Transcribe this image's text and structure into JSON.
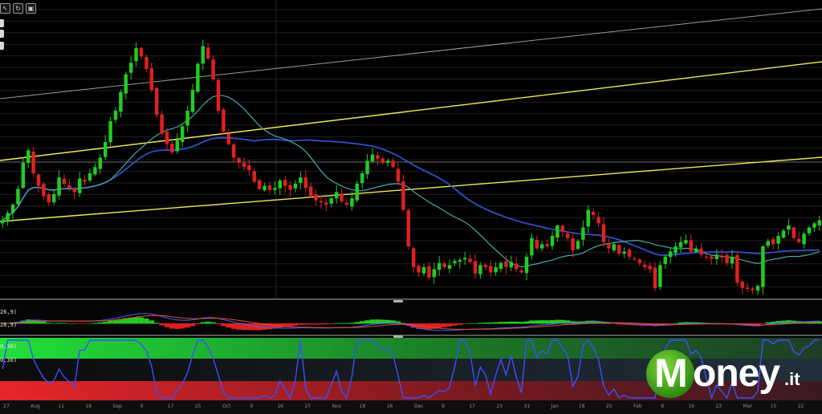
{
  "toolbar": {
    "buttons": [
      {
        "name": "cursor-tool",
        "glyph": "↖"
      },
      {
        "name": "refresh-tool",
        "glyph": "↻"
      },
      {
        "name": "screenshot-tool",
        "glyph": "▣"
      }
    ]
  },
  "indicators": {
    "macd_label_1": "26,9)",
    "macd_label_2": "26,9)",
    "osc_label_1": "0,30)",
    "osc_label_2": "0,30)"
  },
  "logo": {
    "word": "Money",
    "m_letter": "M",
    "word_rest": "oney",
    "ext": ".it"
  },
  "colors": {
    "up": "#22cc22",
    "down": "#e02020",
    "channel": "#f2e85a",
    "trend_gray": "#9a9a9a",
    "ma_blue": "#3050c8",
    "ma_teal": "#4aa8a8",
    "macd_line": "#4a60ff",
    "signal_line": "#e05030",
    "osc_line": "#3a50ff"
  },
  "chart_data": {
    "type": "candlestick",
    "x_labels": [
      "27",
      "Aug",
      "11",
      "18",
      "Sep",
      "9",
      "17",
      "25",
      "Oct",
      "9",
      "16",
      "27",
      "Nov",
      "18",
      "26",
      "Dec",
      "9",
      "17",
      "23",
      "31",
      "Jan",
      "18",
      "25",
      "Feb",
      "8",
      "16",
      "23",
      "Mar",
      "15",
      "22"
    ],
    "close": [
      195,
      202,
      210,
      225,
      250,
      262,
      240,
      228,
      218,
      212,
      220,
      236,
      230,
      226,
      222,
      235,
      232,
      240,
      246,
      255,
      270,
      290,
      300,
      318,
      335,
      346,
      360,
      352,
      340,
      320,
      296,
      278,
      268,
      260,
      272,
      285,
      300,
      320,
      345,
      362,
      350,
      330,
      300,
      280,
      268,
      255,
      250,
      246,
      243,
      232,
      225,
      228,
      224,
      226,
      233,
      228,
      224,
      230,
      236,
      226,
      218,
      214,
      212,
      210,
      216,
      222,
      213,
      210,
      216,
      230,
      240,
      252,
      258,
      254,
      250,
      252,
      246,
      232,
      205,
      170,
      150,
      145,
      150,
      140,
      148,
      154,
      150,
      152,
      156,
      157,
      159,
      155,
      144,
      152,
      150,
      145,
      150,
      154,
      150,
      155,
      148,
      145,
      160,
      178,
      168,
      172,
      170,
      180,
      190,
      184,
      178,
      166,
      175,
      188,
      205,
      200,
      192,
      174,
      168,
      172,
      163,
      165,
      160,
      158,
      154,
      150,
      148,
      130,
      152,
      160,
      165,
      170,
      174,
      176,
      165,
      168,
      162,
      160,
      158,
      162,
      160,
      154,
      160,
      135,
      130,
      129,
      128,
      132,
      170,
      175,
      172,
      180,
      185,
      190,
      178,
      174,
      182,
      188,
      192,
      195
    ],
    "macd": {
      "range": [
        -0.5,
        0.5
      ]
    },
    "oscillator": {
      "range": [
        0,
        100
      ],
      "bands": [
        30,
        70
      ]
    }
  }
}
